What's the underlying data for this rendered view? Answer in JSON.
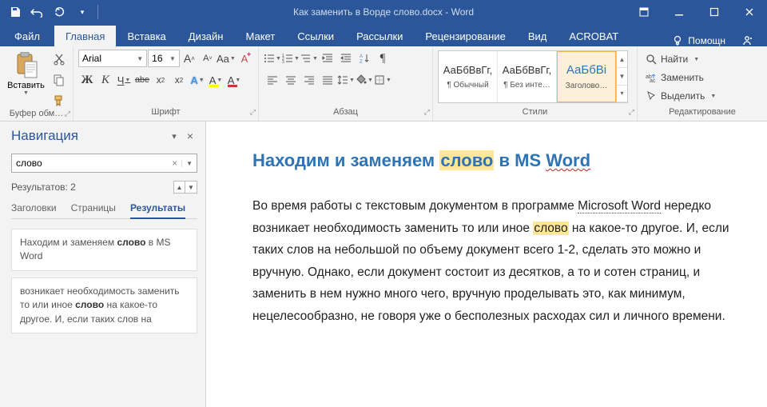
{
  "titlebar": {
    "title": "Как заменить в Ворде слово.docx - Word"
  },
  "tabs": {
    "file": "Файл",
    "home": "Главная",
    "insert": "Вставка",
    "design": "Дизайн",
    "layout": "Макет",
    "references": "Ссылки",
    "mailings": "Рассылки",
    "review": "Рецензирование",
    "view": "Вид",
    "acrobat": "ACROBAT",
    "tell_me": "Помощн"
  },
  "ribbon": {
    "clipboard": {
      "paste": "Вставить",
      "label": "Буфер обм…"
    },
    "font": {
      "name": "Arial",
      "size": "16",
      "label": "Шрифт",
      "bold": "Ж",
      "italic": "К",
      "underline": "Ч",
      "strike": "abe",
      "sub": "x₂",
      "sup": "x²",
      "case": "Aa",
      "clear": "A",
      "grow": "A",
      "shrink": "A",
      "effects": "A",
      "highlight": "A",
      "color": "A"
    },
    "paragraph": {
      "label": "Абзац"
    },
    "styles": {
      "label": "Стили",
      "preview": "АаБбВвГг,",
      "preview_h": "АаБбВі",
      "items": [
        {
          "name": "¶ Обычный"
        },
        {
          "name": "¶ Без инте…"
        },
        {
          "name": "Заголово…"
        }
      ]
    },
    "editing": {
      "label": "Редактирование",
      "find": "Найти",
      "replace": "Заменить",
      "select": "Выделить"
    }
  },
  "nav": {
    "title": "Навигация",
    "search_value": "слово",
    "results_count": "Результатов: 2",
    "tabs": {
      "headings": "Заголовки",
      "pages": "Страницы",
      "results": "Результаты"
    },
    "results": [
      {
        "pre": "Находим и заменяем ",
        "hit": "слово",
        "post": " в MS Word"
      },
      {
        "pre": "возникает необходимость заменить то или иное ",
        "hit": "слово",
        "post": " на какое-то другое. И, если таких слов на"
      }
    ]
  },
  "doc": {
    "heading_pre": "Находим и заменяем ",
    "heading_hit": "слово",
    "heading_mid": " в MS ",
    "heading_wavy": "Word",
    "body_1": "Во время работы с текстовым документом в программе ",
    "body_ms": "Microsoft Word",
    "body_2": " нередко возникает необходимость заменить то или иное ",
    "body_hit": "слово",
    "body_3": " на какое-то другое. И, если таких слов на небольшой по объему документ всего 1-2, сделать это можно и вручную. Однако, если документ состоит из десятков, а то и сотен страниц, и заменить в нем нужно много чего, вручную проделывать это, как минимум, нецелесообразно, не говоря уже о бесполезных расходах сил и личного времени."
  }
}
